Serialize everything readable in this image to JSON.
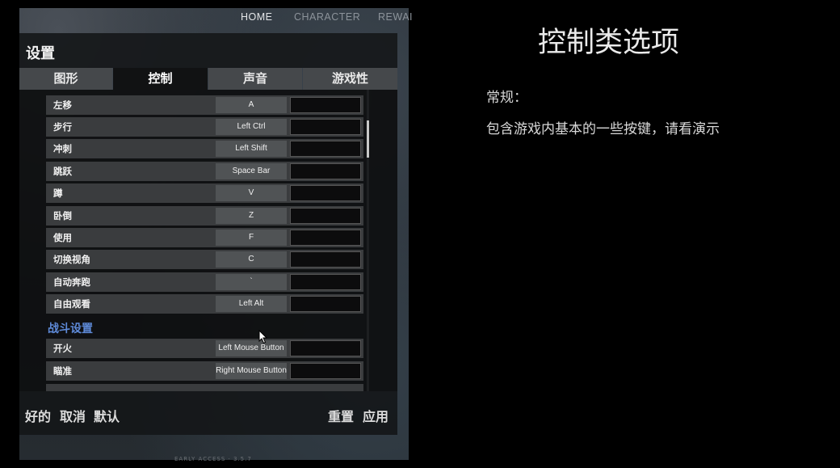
{
  "nav": {
    "items": [
      {
        "label": "HOME",
        "active": true
      },
      {
        "label": "CHARACTER",
        "active": false
      },
      {
        "label": "REWAI",
        "active": false
      }
    ]
  },
  "settings": {
    "title": "设置",
    "tabs": [
      {
        "label": "图形",
        "active": false
      },
      {
        "label": "控制",
        "active": true
      },
      {
        "label": "声音",
        "active": false
      },
      {
        "label": "游戏性",
        "active": false
      }
    ],
    "bindings": [
      {
        "action": "左移",
        "key": "A"
      },
      {
        "action": "步行",
        "key": "Left Ctrl"
      },
      {
        "action": "冲刺",
        "key": "Left Shift"
      },
      {
        "action": "跳跃",
        "key": "Space Bar"
      },
      {
        "action": "蹲",
        "key": "V"
      },
      {
        "action": "卧倒",
        "key": "Z"
      },
      {
        "action": "使用",
        "key": "F"
      },
      {
        "action": "切换视角",
        "key": "C"
      },
      {
        "action": "自动奔跑",
        "key": "`"
      },
      {
        "action": "自由观看",
        "key": "Left Alt"
      }
    ],
    "combat_section": "战斗设置",
    "combat_bindings": [
      {
        "action": "开火",
        "key": "Left Mouse Button"
      },
      {
        "action": "瞄准",
        "key": "Right Mouse Button"
      }
    ],
    "footer": {
      "ok": "好的",
      "cancel": "取消",
      "default": "默认",
      "reset": "重置",
      "apply": "应用"
    },
    "bottom_text": "EARLY ACCESS · 3.5.7"
  },
  "slide": {
    "title": "控制类选项",
    "subtitle": "常规：",
    "description": "包含游戏内基本的一些按键，请看演示"
  },
  "colors": {
    "section_header": "#5e8ad8",
    "active_tab": "#111213",
    "inactive_tab": "#45484b"
  }
}
